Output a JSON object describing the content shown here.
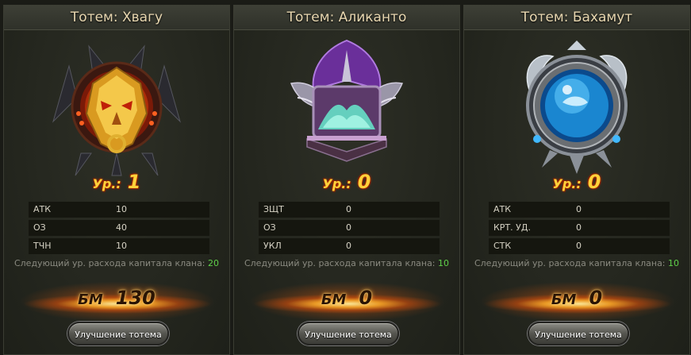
{
  "totems": [
    {
      "title": "Тотем: Хвагу",
      "level_label": "Ур.:",
      "level": "1",
      "stats": [
        {
          "name": "АТК",
          "value": "10"
        },
        {
          "name": "ОЗ",
          "value": "40"
        },
        {
          "name": "ТЧН",
          "value": "10"
        }
      ],
      "next_label": "Следующий ур. расхода капитала клана:",
      "next_value": "20",
      "bm_label": "БМ",
      "bm_value": "130",
      "button": "Улучшение тотема",
      "emblem_icon": "hwagu-demon-mask-icon",
      "emblem_color": "#e0a020"
    },
    {
      "title": "Тотем: Аликанто",
      "level_label": "Ур.:",
      "level": "0",
      "stats": [
        {
          "name": "ЗЩТ",
          "value": "0"
        },
        {
          "name": "ОЗ",
          "value": "0"
        },
        {
          "name": "УКЛ",
          "value": "0"
        }
      ],
      "next_label": "Следующий ур. расхода капитала клана:",
      "next_value": "10",
      "bm_label": "БМ",
      "bm_value": "0",
      "button": "Улучшение тотема",
      "emblem_icon": "alicanto-winged-book-icon",
      "emblem_color": "#8a4fc0"
    },
    {
      "title": "Тотем: Бахамут",
      "level_label": "Ур.:",
      "level": "0",
      "stats": [
        {
          "name": "АТК",
          "value": "0"
        },
        {
          "name": "КРТ. УД.",
          "value": "0"
        },
        {
          "name": "СТК",
          "value": "0"
        }
      ],
      "next_label": "Следующий ур. расхода капитала клана:",
      "next_value": "10",
      "bm_label": "БМ",
      "bm_value": "0",
      "button": "Улучшение тотема",
      "emblem_icon": "bahamut-water-orb-icon",
      "emblem_color": "#2fa8e0"
    }
  ]
}
